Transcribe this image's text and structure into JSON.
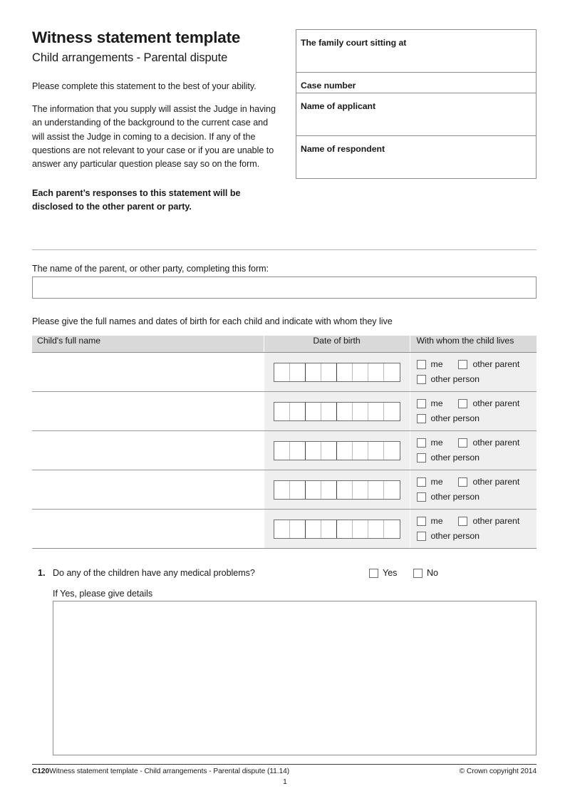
{
  "header": {
    "title": "Witness statement template",
    "subtitle": "Child arrangements - Parental dispute",
    "intro_1": "Please complete this statement to the best of your ability.",
    "intro_2": "The information that you supply will assist the Judge in having an understanding of the background to the current case and will assist the Judge in coming to a decision. If any of the questions are not relevant to your case or if you are unable to answer any particular question please say so on the form.",
    "notice": "Each parent’s responses to this statement will be disclosed to the other parent or party."
  },
  "court_box": {
    "rows": [
      {
        "label": "The family court sitting at",
        "value": ""
      },
      {
        "label": "Case number",
        "value": ""
      },
      {
        "label": "Name of applicant",
        "value": ""
      },
      {
        "label": "Name of respondent",
        "value": ""
      }
    ]
  },
  "parent_name": {
    "label": "The name of the parent, or other party, completing this form:",
    "value": "",
    "placeholder": ""
  },
  "children": {
    "instruction": "Please give the full names and dates of birth for each child and indicate with whom they live",
    "columns": [
      "Child's full name",
      "Date of birth",
      "With whom the child lives"
    ],
    "checkbox_options": [
      "me",
      "other parent",
      "other person"
    ],
    "dob_cell_count": 8,
    "rows": [
      {
        "name": "",
        "dob": [
          "",
          "",
          "",
          "",
          "",
          "",
          "",
          ""
        ],
        "lives_with": ""
      },
      {
        "name": "",
        "dob": [
          "",
          "",
          "",
          "",
          "",
          "",
          "",
          ""
        ],
        "lives_with": ""
      },
      {
        "name": "",
        "dob": [
          "",
          "",
          "",
          "",
          "",
          "",
          "",
          ""
        ],
        "lives_with": ""
      },
      {
        "name": "",
        "dob": [
          "",
          "",
          "",
          "",
          "",
          "",
          "",
          ""
        ],
        "lives_with": ""
      },
      {
        "name": "",
        "dob": [
          "",
          "",
          "",
          "",
          "",
          "",
          "",
          ""
        ],
        "lives_with": ""
      }
    ]
  },
  "question_1": {
    "number": "1.",
    "text": "Do any of the children have any medical problems?",
    "yes_label": "Yes",
    "no_label": "No",
    "sublabel": "If Yes, please give details",
    "details_value": ""
  },
  "footer": {
    "code": "C120",
    "description": "Witness statement template - Child arrangements - Parental dispute  (11.14)",
    "copyright": "© Crown copyright 2014",
    "page_number": "1"
  },
  "colors": {
    "header_row_bg": "#d9d9d9",
    "body_cell_bg": "#efefef",
    "border": "#8d8d8d",
    "text": "#1a1a1a"
  }
}
